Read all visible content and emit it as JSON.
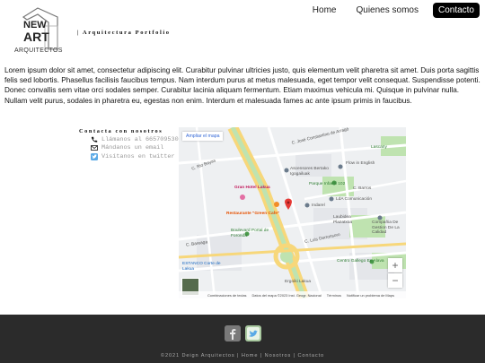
{
  "brand": {
    "name_line1": "NEW",
    "name_line2": "ART",
    "sub": "ARQUITECTOS"
  },
  "header": {
    "tagline": "| Arquitectura Portfolio"
  },
  "nav": {
    "items": [
      "Home",
      "Quienes somos",
      "Contacto"
    ],
    "active": "Contacto"
  },
  "intro": {
    "text": "Lorem ipsum dolor sit amet, consectetur adipiscing elit. Curabitur pulvinar ultricies justo, quis elementum velit pharetra sit amet. Duis porta sagittis felis sed lobortis. Phasellus facilisis faucibus tempus. Nam interdum purus at metus malesuada, eget tempor velit consequat. Suspendisse potenti. Donec convallis sem vitae orci sodales semper. Curabitur lacinia aliquam fermentum. Etiam maximus vehicula mi. Quisque in pulvinar nulla. Nullam velit purus, sodales in pharetra eu, egestas non enim. Interdum et malesuada fames ac ante ipsum primis in faucibus."
  },
  "contact": {
    "title": "Contacta con nosotros",
    "items": [
      {
        "icon": "phone-icon",
        "text": "Llámanos al 665709530"
      },
      {
        "icon": "mail-icon",
        "text": "Mándanos un email"
      },
      {
        "icon": "twitter-icon",
        "text": "Visítanos en twitter"
      }
    ]
  },
  "map": {
    "enlarge_label": "Ampliar el mapa",
    "places": [
      "Lascany",
      "C. José Constantino de Arragó",
      "Flow in English",
      "C. Rio Bayas",
      "Ascensores Bertako Igogailuak",
      "Parque Infantil 102",
      "Gran Hotel Lakua",
      "C. Barros",
      "LdA Comunicación",
      "Indarel",
      "Restaurante \"Green Cafe\"",
      "Laubidea Plazatxoa",
      "Compañia De Gestion De La Calidad",
      "Boulevard Portal de Foronda",
      "C. Luis Dorronsoro",
      "C. Bareaga",
      "Centro Gallego En Alava",
      "ESTANCO Corte de Lakua",
      "Ergoiki Lakua"
    ],
    "footer": [
      "Combinaciones de teclas",
      "Datos del mapa ©2023 Inst. Geogr. Nacional",
      "Términos",
      "Notificar un problema de Maps"
    ],
    "zoom_in": "+",
    "zoom_out": "−"
  },
  "footer": {
    "copyright": "©2021 Deign Arquitectos | Home | Nosotros | Contacto",
    "social": [
      "facebook-icon",
      "twitter-icon"
    ]
  },
  "colors": {
    "accent": "#000000",
    "footer_bg": "#2b2b2b",
    "road_main": "#f7d77a",
    "park": "#bfe3b0"
  }
}
